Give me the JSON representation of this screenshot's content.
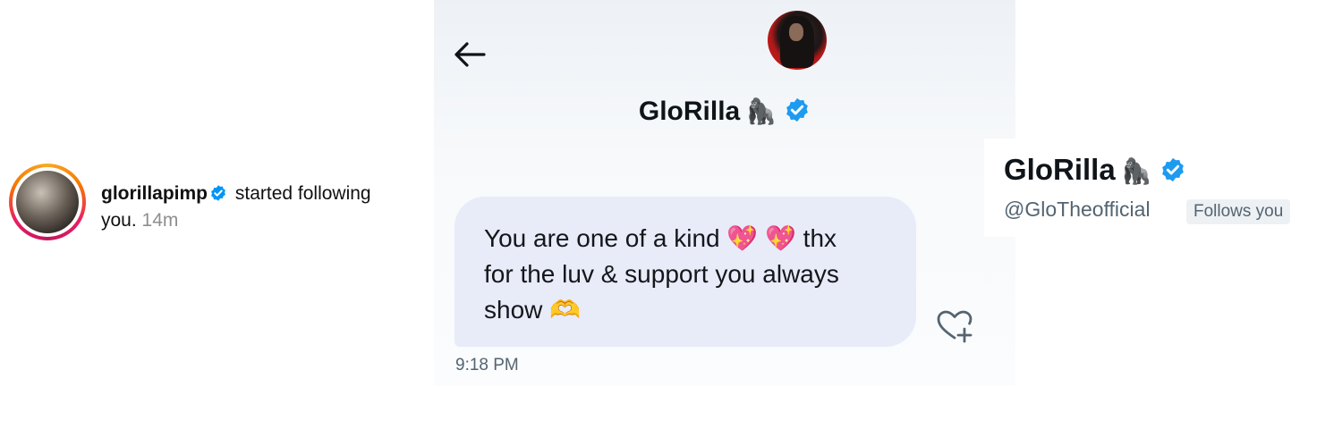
{
  "instagram": {
    "username": "glorillapimp",
    "action": "started following",
    "action_end": "you.",
    "time": "14m",
    "badge_icon": "verified-badge-icon"
  },
  "dm": {
    "back_icon": "arrow-left-icon",
    "display_name": "GloRilla",
    "name_emoji": "🦍",
    "message_line1": "You are one of a kind 💖 💖 thx",
    "message_line2": "for the luv & support you always",
    "message_line3": "show 🫶",
    "timestamp": "9:18 PM",
    "react_icon": "heart-plus-icon"
  },
  "profile": {
    "display_name": "GloRilla",
    "name_emoji": "🦍",
    "handle": "@GloTheofficial",
    "follows_you": "Follows you"
  },
  "colors": {
    "verified_blue": "#1d9bf0",
    "ig_verified_blue": "#0095f6",
    "bubble_bg": "#e8ebf8"
  }
}
